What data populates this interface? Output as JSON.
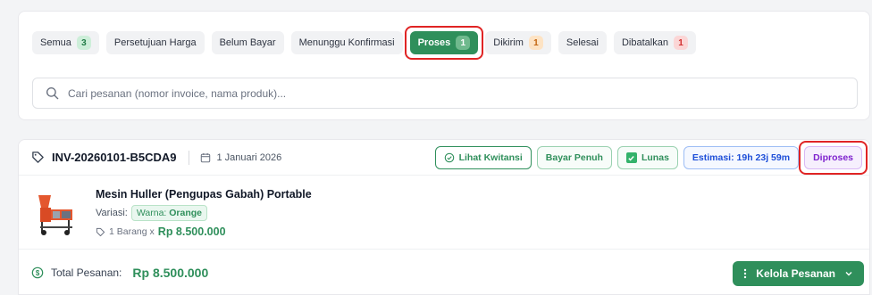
{
  "tabs": [
    {
      "label": "Semua",
      "count": "3",
      "badge": "green"
    },
    {
      "label": "Persetujuan Harga"
    },
    {
      "label": "Belum Bayar"
    },
    {
      "label": "Menunggu Konfirmasi"
    },
    {
      "label": "Proses",
      "count": "1",
      "badge": "active",
      "active": true
    },
    {
      "label": "Dikirim",
      "count": "1",
      "badge": "orange"
    },
    {
      "label": "Selesai"
    },
    {
      "label": "Dibatalkan",
      "count": "1",
      "badge": "red"
    }
  ],
  "search": {
    "placeholder": "Cari pesanan (nomor invoice, nama produk)...",
    "value": ""
  },
  "order": {
    "invoice": "INV-20260101-B5CDA9",
    "date": "1 Januari 2026",
    "actions": {
      "receipt": "Lihat Kwitansi",
      "payment_type": "Bayar Penuh",
      "paid": "Lunas",
      "estimate": "Estimasi: 19h 23j 59m",
      "status": "Diproses"
    },
    "product": {
      "name": "Mesin Huller (Pengupas Gabah) Portable",
      "variant_label": "Variasi:",
      "variant_key": "Warna:",
      "variant_value": "Orange",
      "qty_text": "1 Barang x",
      "price": "Rp 8.500.000"
    },
    "total_label": "Total Pesanan:",
    "total_value": "Rp 8.500.000",
    "manage_label": "Kelola Pesanan"
  },
  "colors": {
    "accent": "#2f8f5b",
    "highlight": "#e02424",
    "status_purple": "#7e22ce",
    "estimate_blue": "#1d4ed8"
  },
  "icons": [
    "search-icon",
    "tag-icon",
    "calendar-icon",
    "check-circle-icon",
    "checkbox-icon",
    "dollar-circle-icon",
    "more-vertical-icon",
    "chevron-down-icon"
  ]
}
